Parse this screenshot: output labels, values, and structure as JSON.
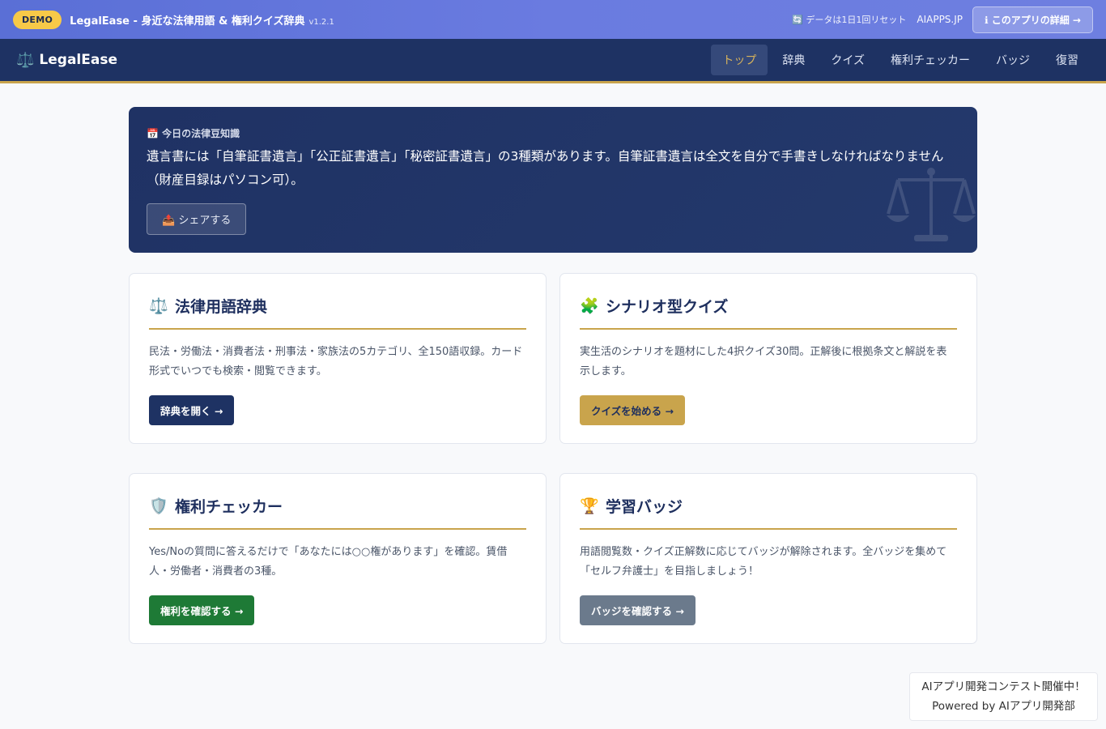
{
  "demo_bar": {
    "badge": "DEMO",
    "title": "LegalEase - 身近な法律用語 & 権利クイズ辞典",
    "version": "v1.2.1",
    "reset_text": "🔄 データは1日1回リセット",
    "site": "AIAPPS.JP",
    "detail_button": "ℹ このアプリの詳細 →"
  },
  "nav": {
    "logo_icon": "⚖️",
    "logo_text": "LegalEase",
    "links": [
      "トップ",
      "辞典",
      "クイズ",
      "権利チェッカー",
      "バッジ",
      "復習"
    ],
    "active_index": 0
  },
  "hero": {
    "label": "📅 今日の法律豆知識",
    "text": "遺言書には「自筆証書遺言」「公正証書遺言」「秘密証書遺言」の3種類があります。自筆証書遺言は全文を自分で手書きしなければなりません（財産目録はパソコン可）。",
    "share_button": "📤 シェアする"
  },
  "cards": [
    {
      "icon": "⚖️",
      "title": "法律用語辞典",
      "description": "民法・労働法・消費者法・刑事法・家族法の5カテゴリ、全150語収録。カード形式でいつでも検索・閲覧できます。",
      "button": "辞典を開く →",
      "button_color": "#1e3263"
    },
    {
      "icon": "🧩",
      "title": "シナリオ型クイズ",
      "description": "実生活のシナリオを題材にした4択クイズ30問。正解後に根拠条文と解説を表示します。",
      "button": "クイズを始める →",
      "button_color": "#c9a44c"
    },
    {
      "icon": "🛡️",
      "title": "権利チェッカー",
      "description": "Yes/Noの質問に答えるだけで「あなたには○○権があります」を確認。賃借人・労働者・消費者の3種。",
      "button": "権利を確認する →",
      "button_color": "#1e7a36"
    },
    {
      "icon": "🏆",
      "title": "学習バッジ",
      "description": "用語閲覧数・クイズ正解数に応じてバッジが解除されます。全バッジを集めて「セルフ弁護士」を目指しましょう！",
      "button": "バッジを確認する →",
      "button_color": "#6b7a8c"
    }
  ],
  "contest": {
    "line1": "AIアプリ開発コンテスト開催中！",
    "line2": "Powered by AIアプリ開発部"
  }
}
